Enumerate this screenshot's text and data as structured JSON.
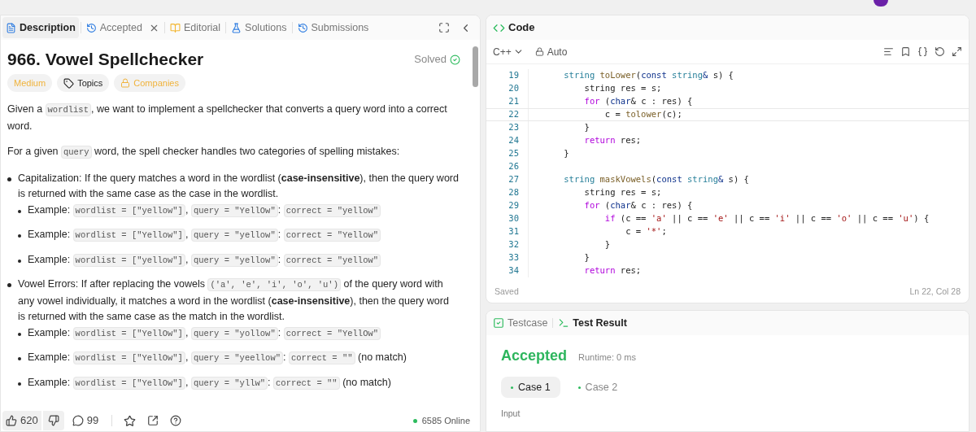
{
  "description_panel": {
    "tabs": [
      {
        "label": "Description",
        "selected": true,
        "closable": false
      },
      {
        "label": "Accepted",
        "selected": false,
        "closable": true
      },
      {
        "label": "Editorial",
        "selected": false,
        "closable": false
      },
      {
        "label": "Solutions",
        "selected": false,
        "closable": false
      },
      {
        "label": "Submissions",
        "selected": false,
        "closable": false
      }
    ],
    "title": "966. Vowel Spellchecker",
    "status": "Solved",
    "tags": [
      {
        "label": "Medium",
        "kind": "difficulty"
      },
      {
        "label": "Topics",
        "kind": "topics"
      },
      {
        "label": "Companies",
        "kind": "locked"
      }
    ],
    "paragraphs": [
      [
        {
          "kind": "text",
          "text": "Given a "
        },
        {
          "kind": "code",
          "text": "wordlist"
        },
        {
          "kind": "text",
          "text": ", we want to implement a spellchecker that converts a query word into a correct word."
        }
      ],
      [
        {
          "kind": "text",
          "text": "For a given "
        },
        {
          "kind": "code",
          "text": "query"
        },
        {
          "kind": "text",
          "text": " word, the spell checker handles two categories of spelling mistakes:"
        }
      ]
    ],
    "bullets": [
      {
        "parts": [
          {
            "kind": "text",
            "text": "Capitalization: If the query matches a word in the wordlist (**case-insensitive**), then the query word is returned with the same case as the case in the wordlist."
          }
        ],
        "children": [
          [
            {
              "kind": "text",
              "text": "Example: "
            },
            {
              "kind": "code",
              "text": "wordlist = [\"yellow\"]"
            },
            {
              "kind": "text",
              "text": ", "
            },
            {
              "kind": "code",
              "text": "query = \"YellOw\""
            },
            {
              "kind": "text",
              "text": ": "
            },
            {
              "kind": "code",
              "text": "correct = \"yellow\""
            }
          ],
          [
            {
              "kind": "text",
              "text": "Example: "
            },
            {
              "kind": "code",
              "text": "wordlist = [\"Yellow\"]"
            },
            {
              "kind": "text",
              "text": ", "
            },
            {
              "kind": "code",
              "text": "query = \"yellow\""
            },
            {
              "kind": "text",
              "text": ": "
            },
            {
              "kind": "code",
              "text": "correct = \"Yellow\""
            }
          ],
          [
            {
              "kind": "text",
              "text": "Example: "
            },
            {
              "kind": "code",
              "text": "wordlist = [\"yellow\"]"
            },
            {
              "kind": "text",
              "text": ", "
            },
            {
              "kind": "code",
              "text": "query = \"yellow\""
            },
            {
              "kind": "text",
              "text": ": "
            },
            {
              "kind": "code",
              "text": "correct = \"yellow\""
            }
          ]
        ]
      },
      {
        "parts": [
          {
            "kind": "text",
            "text": "Vowel Errors: If after replacing the vowels "
          },
          {
            "kind": "code",
            "text": "('a', 'e', 'i', 'o', 'u')"
          },
          {
            "kind": "text",
            "text": " of the query word with any vowel individually, it matches a word in the wordlist (**case-insensitive**), then the query word is returned with the same case as the match in the wordlist."
          }
        ],
        "children": [
          [
            {
              "kind": "text",
              "text": "Example: "
            },
            {
              "kind": "code",
              "text": "wordlist = [\"YellOw\"]"
            },
            {
              "kind": "text",
              "text": ", "
            },
            {
              "kind": "code",
              "text": "query = \"yollow\""
            },
            {
              "kind": "text",
              "text": ": "
            },
            {
              "kind": "code",
              "text": "correct = \"YellOw\""
            }
          ],
          [
            {
              "kind": "text",
              "text": "Example: "
            },
            {
              "kind": "code",
              "text": "wordlist = [\"YellOw\"]"
            },
            {
              "kind": "text",
              "text": ", "
            },
            {
              "kind": "code",
              "text": "query = \"yeellow\""
            },
            {
              "kind": "text",
              "text": ": "
            },
            {
              "kind": "code",
              "text": "correct = \"\""
            },
            {
              "kind": "text",
              "text": " (no match)"
            }
          ],
          [
            {
              "kind": "text",
              "text": "Example: "
            },
            {
              "kind": "code",
              "text": "wordlist = [\"YellOw\"]"
            },
            {
              "kind": "text",
              "text": ", "
            },
            {
              "kind": "code",
              "text": "query = \"yllw\""
            },
            {
              "kind": "text",
              "text": ": "
            },
            {
              "kind": "code",
              "text": "correct = \"\""
            },
            {
              "kind": "text",
              "text": " (no match)"
            }
          ]
        ]
      }
    ],
    "footer": {
      "likes": "620",
      "comments": "99",
      "online": "6585 Online"
    }
  },
  "code_panel": {
    "title": "Code",
    "language": "C++",
    "mode": "Auto",
    "lines": [
      {
        "number": "19",
        "current": false,
        "tokens": [
          {
            "kind": "type",
            "text": "    string"
          },
          {
            "kind": "func",
            "text": " toLower"
          },
          {
            "kind": "plain",
            "text": "("
          },
          {
            "kind": "storage",
            "text": "const"
          },
          {
            "kind": "type",
            "text": " string"
          },
          {
            "kind": "storage",
            "text": "&"
          },
          {
            "kind": "plain",
            "text": " s) {"
          }
        ]
      },
      {
        "number": "20",
        "current": false,
        "tokens": [
          {
            "kind": "plain",
            "text": "        string res = s;"
          }
        ]
      },
      {
        "number": "21",
        "current": false,
        "tokens": [
          {
            "kind": "control",
            "text": "        for"
          },
          {
            "kind": "plain",
            "text": " ("
          },
          {
            "kind": "storage",
            "text": "char"
          },
          {
            "kind": "plain",
            "text": "& c : res) {"
          }
        ]
      },
      {
        "number": "22",
        "current": true,
        "tokens": [
          {
            "kind": "plain",
            "text": "            c = "
          },
          {
            "kind": "func",
            "text": "tolower"
          },
          {
            "kind": "plain",
            "text": "(c);"
          }
        ]
      },
      {
        "number": "23",
        "current": false,
        "tokens": [
          {
            "kind": "plain",
            "text": "        }"
          }
        ]
      },
      {
        "number": "24",
        "current": false,
        "tokens": [
          {
            "kind": "control",
            "text": "        return"
          },
          {
            "kind": "plain",
            "text": " res;"
          }
        ]
      },
      {
        "number": "25",
        "current": false,
        "tokens": [
          {
            "kind": "plain",
            "text": "    }"
          }
        ]
      },
      {
        "number": "26",
        "current": false
      },
      {
        "number": "27",
        "current": false,
        "tokens": [
          {
            "kind": "type",
            "text": "    string"
          },
          {
            "kind": "func",
            "text": " maskVowels"
          },
          {
            "kind": "plain",
            "text": "("
          },
          {
            "kind": "storage",
            "text": "const"
          },
          {
            "kind": "type",
            "text": " string"
          },
          {
            "kind": "storage",
            "text": "&"
          },
          {
            "kind": "plain",
            "text": " s) {"
          }
        ]
      },
      {
        "number": "28",
        "current": false,
        "tokens": [
          {
            "kind": "plain",
            "text": "        string res = s;"
          }
        ]
      },
      {
        "number": "29",
        "current": false,
        "tokens": [
          {
            "kind": "control",
            "text": "        for"
          },
          {
            "kind": "plain",
            "text": " ("
          },
          {
            "kind": "storage",
            "text": "char"
          },
          {
            "kind": "plain",
            "text": "& c : res) {"
          }
        ]
      },
      {
        "number": "30",
        "current": false,
        "tokens": [
          {
            "kind": "control",
            "text": "            if"
          },
          {
            "kind": "plain",
            "text": " (c == "
          },
          {
            "kind": "str",
            "text": "'a'"
          },
          {
            "kind": "plain",
            "text": " || c == "
          },
          {
            "kind": "str",
            "text": "'e'"
          },
          {
            "kind": "plain",
            "text": " || c == "
          },
          {
            "kind": "str",
            "text": "'i'"
          },
          {
            "kind": "plain",
            "text": " || c == "
          },
          {
            "kind": "str",
            "text": "'o'"
          },
          {
            "kind": "plain",
            "text": " || c == "
          },
          {
            "kind": "str",
            "text": "'u'"
          },
          {
            "kind": "plain",
            "text": ") {"
          }
        ]
      },
      {
        "number": "31",
        "current": false,
        "tokens": [
          {
            "kind": "plain",
            "text": "                c = "
          },
          {
            "kind": "str",
            "text": "'*'"
          },
          {
            "kind": "plain",
            "text": ";"
          }
        ]
      },
      {
        "number": "32",
        "current": false,
        "tokens": [
          {
            "kind": "plain",
            "text": "            }"
          }
        ]
      },
      {
        "number": "33",
        "current": false,
        "tokens": [
          {
            "kind": "plain",
            "text": "        }"
          }
        ]
      },
      {
        "number": "34",
        "current": false,
        "tokens": [
          {
            "kind": "control",
            "text": "        return"
          },
          {
            "kind": "plain",
            "text": " res;"
          }
        ]
      }
    ],
    "saved": "Saved",
    "cursor": "Ln 22, Col 28"
  },
  "result_panel": {
    "tabs": [
      {
        "label": "Testcase",
        "selected": false
      },
      {
        "label": "Test Result",
        "selected": true
      }
    ],
    "verdict": "Accepted",
    "runtime": "Runtime: 0 ms",
    "cases": [
      {
        "label": "Case 1",
        "selected": true
      },
      {
        "label": "Case 2",
        "selected": false
      }
    ],
    "input_label": "Input"
  }
}
